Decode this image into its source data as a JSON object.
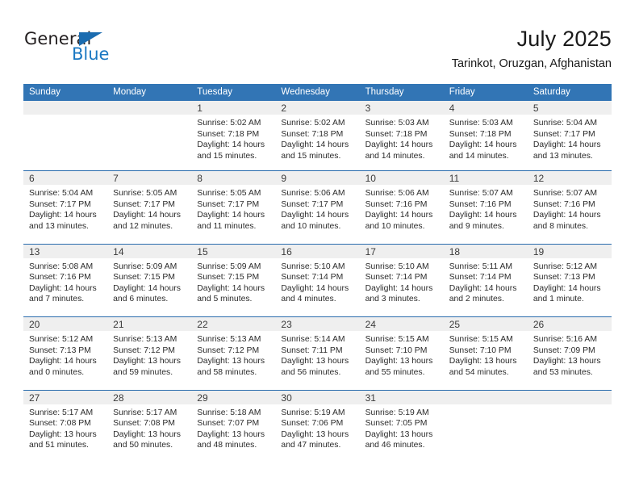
{
  "brand": {
    "name_part1": "General",
    "name_part2": "Blue",
    "triangle_color": "#1b6cb0",
    "blue_color": "#1b78c2"
  },
  "header": {
    "title": "July 2025",
    "subtitle": "Tarinkot, Oruzgan, Afghanistan"
  },
  "theme": {
    "header_blue": "#3275b5",
    "row_divider_blue": "#2a6cad",
    "day_band_gray": "#efefef"
  },
  "weekdays": [
    "Sunday",
    "Monday",
    "Tuesday",
    "Wednesday",
    "Thursday",
    "Friday",
    "Saturday"
  ],
  "labels": {
    "sunrise_prefix": "Sunrise:",
    "sunset_prefix": "Sunset:",
    "daylight_prefix": "Daylight:"
  },
  "weeks": [
    [
      {
        "day": "",
        "empty": true
      },
      {
        "day": "",
        "empty": true
      },
      {
        "day": "1",
        "sunrise": "Sunrise: 5:02 AM",
        "sunset": "Sunset: 7:18 PM",
        "daylight_l1": "Daylight: 14 hours",
        "daylight_l2": "and 15 minutes."
      },
      {
        "day": "2",
        "sunrise": "Sunrise: 5:02 AM",
        "sunset": "Sunset: 7:18 PM",
        "daylight_l1": "Daylight: 14 hours",
        "daylight_l2": "and 15 minutes."
      },
      {
        "day": "3",
        "sunrise": "Sunrise: 5:03 AM",
        "sunset": "Sunset: 7:18 PM",
        "daylight_l1": "Daylight: 14 hours",
        "daylight_l2": "and 14 minutes."
      },
      {
        "day": "4",
        "sunrise": "Sunrise: 5:03 AM",
        "sunset": "Sunset: 7:18 PM",
        "daylight_l1": "Daylight: 14 hours",
        "daylight_l2": "and 14 minutes."
      },
      {
        "day": "5",
        "sunrise": "Sunrise: 5:04 AM",
        "sunset": "Sunset: 7:17 PM",
        "daylight_l1": "Daylight: 14 hours",
        "daylight_l2": "and 13 minutes."
      }
    ],
    [
      {
        "day": "6",
        "sunrise": "Sunrise: 5:04 AM",
        "sunset": "Sunset: 7:17 PM",
        "daylight_l1": "Daylight: 14 hours",
        "daylight_l2": "and 13 minutes."
      },
      {
        "day": "7",
        "sunrise": "Sunrise: 5:05 AM",
        "sunset": "Sunset: 7:17 PM",
        "daylight_l1": "Daylight: 14 hours",
        "daylight_l2": "and 12 minutes."
      },
      {
        "day": "8",
        "sunrise": "Sunrise: 5:05 AM",
        "sunset": "Sunset: 7:17 PM",
        "daylight_l1": "Daylight: 14 hours",
        "daylight_l2": "and 11 minutes."
      },
      {
        "day": "9",
        "sunrise": "Sunrise: 5:06 AM",
        "sunset": "Sunset: 7:17 PM",
        "daylight_l1": "Daylight: 14 hours",
        "daylight_l2": "and 10 minutes."
      },
      {
        "day": "10",
        "sunrise": "Sunrise: 5:06 AM",
        "sunset": "Sunset: 7:16 PM",
        "daylight_l1": "Daylight: 14 hours",
        "daylight_l2": "and 10 minutes."
      },
      {
        "day": "11",
        "sunrise": "Sunrise: 5:07 AM",
        "sunset": "Sunset: 7:16 PM",
        "daylight_l1": "Daylight: 14 hours",
        "daylight_l2": "and 9 minutes."
      },
      {
        "day": "12",
        "sunrise": "Sunrise: 5:07 AM",
        "sunset": "Sunset: 7:16 PM",
        "daylight_l1": "Daylight: 14 hours",
        "daylight_l2": "and 8 minutes."
      }
    ],
    [
      {
        "day": "13",
        "sunrise": "Sunrise: 5:08 AM",
        "sunset": "Sunset: 7:16 PM",
        "daylight_l1": "Daylight: 14 hours",
        "daylight_l2": "and 7 minutes."
      },
      {
        "day": "14",
        "sunrise": "Sunrise: 5:09 AM",
        "sunset": "Sunset: 7:15 PM",
        "daylight_l1": "Daylight: 14 hours",
        "daylight_l2": "and 6 minutes."
      },
      {
        "day": "15",
        "sunrise": "Sunrise: 5:09 AM",
        "sunset": "Sunset: 7:15 PM",
        "daylight_l1": "Daylight: 14 hours",
        "daylight_l2": "and 5 minutes."
      },
      {
        "day": "16",
        "sunrise": "Sunrise: 5:10 AM",
        "sunset": "Sunset: 7:14 PM",
        "daylight_l1": "Daylight: 14 hours",
        "daylight_l2": "and 4 minutes."
      },
      {
        "day": "17",
        "sunrise": "Sunrise: 5:10 AM",
        "sunset": "Sunset: 7:14 PM",
        "daylight_l1": "Daylight: 14 hours",
        "daylight_l2": "and 3 minutes."
      },
      {
        "day": "18",
        "sunrise": "Sunrise: 5:11 AM",
        "sunset": "Sunset: 7:14 PM",
        "daylight_l1": "Daylight: 14 hours",
        "daylight_l2": "and 2 minutes."
      },
      {
        "day": "19",
        "sunrise": "Sunrise: 5:12 AM",
        "sunset": "Sunset: 7:13 PM",
        "daylight_l1": "Daylight: 14 hours",
        "daylight_l2": "and 1 minute."
      }
    ],
    [
      {
        "day": "20",
        "sunrise": "Sunrise: 5:12 AM",
        "sunset": "Sunset: 7:13 PM",
        "daylight_l1": "Daylight: 14 hours",
        "daylight_l2": "and 0 minutes."
      },
      {
        "day": "21",
        "sunrise": "Sunrise: 5:13 AM",
        "sunset": "Sunset: 7:12 PM",
        "daylight_l1": "Daylight: 13 hours",
        "daylight_l2": "and 59 minutes."
      },
      {
        "day": "22",
        "sunrise": "Sunrise: 5:13 AM",
        "sunset": "Sunset: 7:12 PM",
        "daylight_l1": "Daylight: 13 hours",
        "daylight_l2": "and 58 minutes."
      },
      {
        "day": "23",
        "sunrise": "Sunrise: 5:14 AM",
        "sunset": "Sunset: 7:11 PM",
        "daylight_l1": "Daylight: 13 hours",
        "daylight_l2": "and 56 minutes."
      },
      {
        "day": "24",
        "sunrise": "Sunrise: 5:15 AM",
        "sunset": "Sunset: 7:10 PM",
        "daylight_l1": "Daylight: 13 hours",
        "daylight_l2": "and 55 minutes."
      },
      {
        "day": "25",
        "sunrise": "Sunrise: 5:15 AM",
        "sunset": "Sunset: 7:10 PM",
        "daylight_l1": "Daylight: 13 hours",
        "daylight_l2": "and 54 minutes."
      },
      {
        "day": "26",
        "sunrise": "Sunrise: 5:16 AM",
        "sunset": "Sunset: 7:09 PM",
        "daylight_l1": "Daylight: 13 hours",
        "daylight_l2": "and 53 minutes."
      }
    ],
    [
      {
        "day": "27",
        "sunrise": "Sunrise: 5:17 AM",
        "sunset": "Sunset: 7:08 PM",
        "daylight_l1": "Daylight: 13 hours",
        "daylight_l2": "and 51 minutes."
      },
      {
        "day": "28",
        "sunrise": "Sunrise: 5:17 AM",
        "sunset": "Sunset: 7:08 PM",
        "daylight_l1": "Daylight: 13 hours",
        "daylight_l2": "and 50 minutes."
      },
      {
        "day": "29",
        "sunrise": "Sunrise: 5:18 AM",
        "sunset": "Sunset: 7:07 PM",
        "daylight_l1": "Daylight: 13 hours",
        "daylight_l2": "and 48 minutes."
      },
      {
        "day": "30",
        "sunrise": "Sunrise: 5:19 AM",
        "sunset": "Sunset: 7:06 PM",
        "daylight_l1": "Daylight: 13 hours",
        "daylight_l2": "and 47 minutes."
      },
      {
        "day": "31",
        "sunrise": "Sunrise: 5:19 AM",
        "sunset": "Sunset: 7:05 PM",
        "daylight_l1": "Daylight: 13 hours",
        "daylight_l2": "and 46 minutes."
      },
      {
        "day": "",
        "empty": true
      },
      {
        "day": "",
        "empty": true
      }
    ]
  ]
}
